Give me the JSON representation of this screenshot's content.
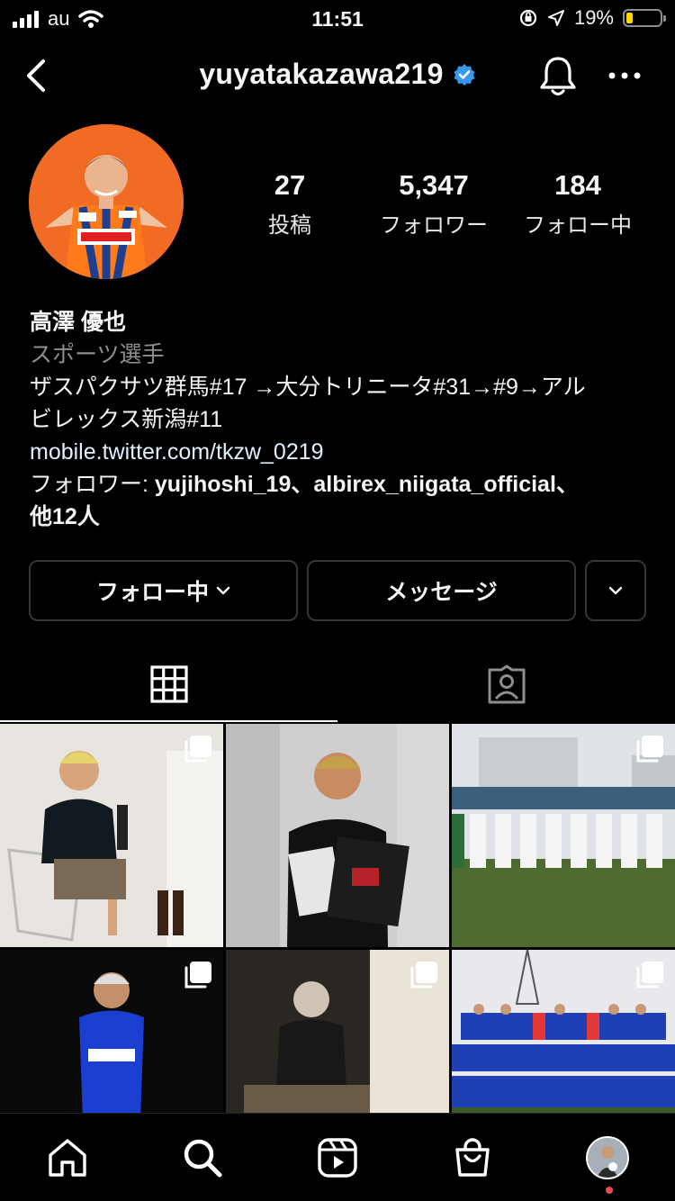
{
  "status_bar": {
    "carrier": "au",
    "time": "11:51",
    "battery": "19%",
    "battery_level": 0.19
  },
  "header": {
    "username": "yuyatakazawa219",
    "icons": [
      "back-arrow-icon",
      "verified-badge-icon",
      "bell-icon",
      "more-icon"
    ]
  },
  "profile": {
    "stats": [
      {
        "value": "27",
        "label": "投稿"
      },
      {
        "value": "5,347",
        "label": "フォロワー"
      },
      {
        "value": "184",
        "label": "フォロー中"
      }
    ],
    "name": "高澤 優也",
    "category": "スポーツ選手",
    "bio_line1": "ザスパクサツ群馬#17 →大分トリニータ#31→#9→アル",
    "bio_line2": "ビレックス新潟#11",
    "link": "mobile.twitter.com/tkzw_0219",
    "followers_prefix": "フォロワー: ",
    "followers_names": "yujihoshi_19、albirex_niigata_official、",
    "followers_suffix": "他12人"
  },
  "buttons": {
    "following": "フォロー中",
    "message": "メッセージ"
  },
  "tabs": [
    "grid-icon",
    "tagged-icon"
  ],
  "nav": [
    "home-icon",
    "search-icon",
    "reels-icon",
    "shop-icon",
    "profile-avatar"
  ],
  "colors": {
    "background": "#000000",
    "link": "#e0f1ff",
    "secondary": "#8e8e8e",
    "accent": "#3897f0",
    "notification": "#ed4956"
  }
}
